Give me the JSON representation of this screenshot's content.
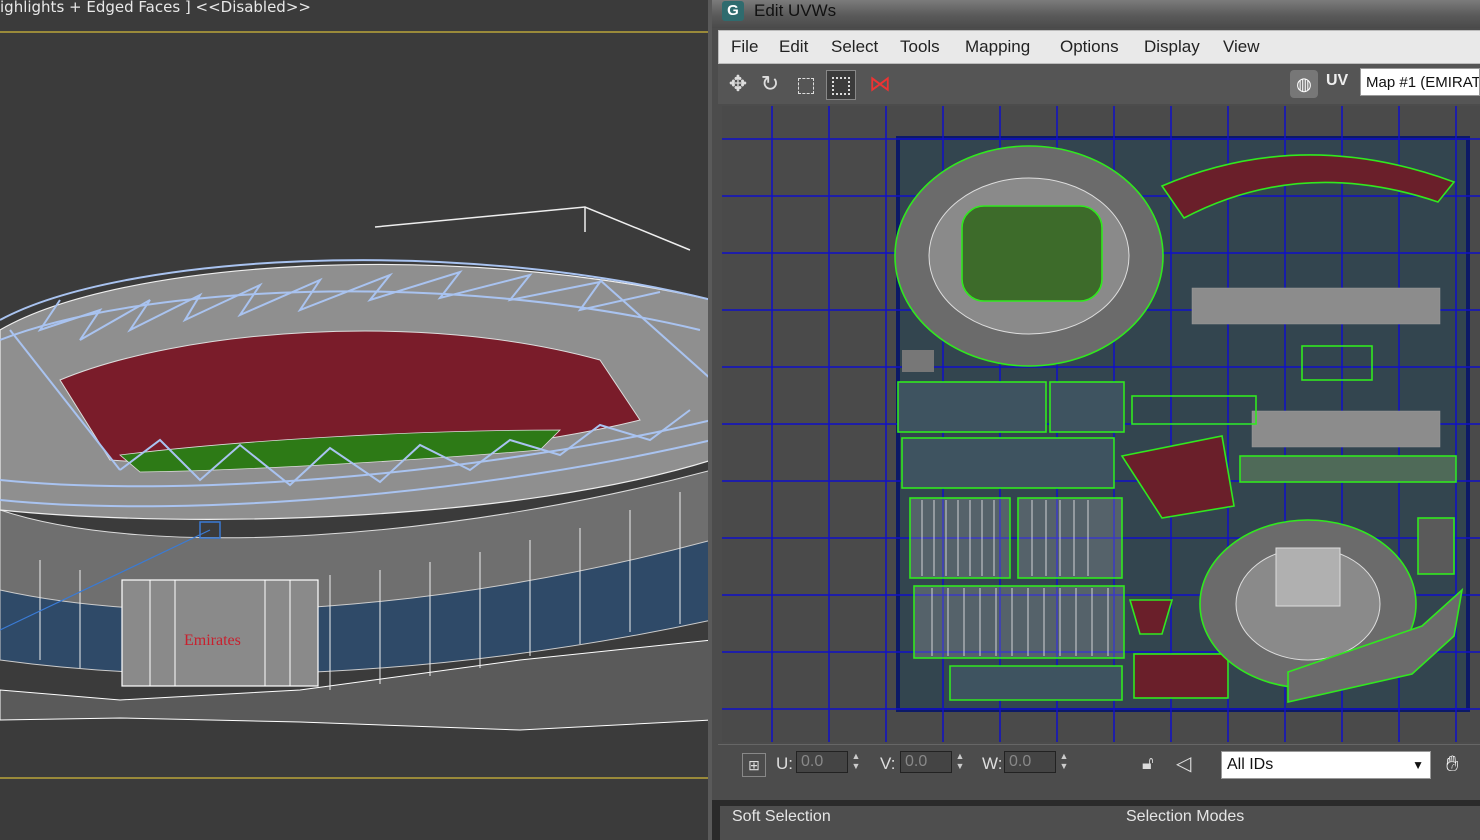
{
  "viewport": {
    "label": "ighlights + Edged Faces ] <<Disabled>>",
    "logo_text": "Emirates"
  },
  "window": {
    "title": "Edit UVWs"
  },
  "menu": {
    "items": [
      "File",
      "Edit",
      "Select",
      "Tools",
      "Mapping",
      "Options",
      "Display",
      "View"
    ]
  },
  "toolbar": {
    "icons": [
      "move-icon",
      "rotate-icon",
      "scale-icon",
      "freeform-icon",
      "mirror-icon"
    ],
    "uv_label": "UV",
    "map_channel": "Map #1 (EMIRAT"
  },
  "status": {
    "u_label": "U:",
    "u_value": "0.0",
    "v_label": "V:",
    "v_value": "0.0",
    "w_label": "W:",
    "w_value": "0.0",
    "ids_value": "All IDs"
  },
  "rollouts": {
    "soft_selection": "Soft Selection",
    "selection_modes": "Selection Modes"
  },
  "colors": {
    "grid": "#1010c8",
    "uv_edges": "#31e81f",
    "wireframe": "#a9c3f0",
    "seat_red": "#7a1c2a"
  }
}
